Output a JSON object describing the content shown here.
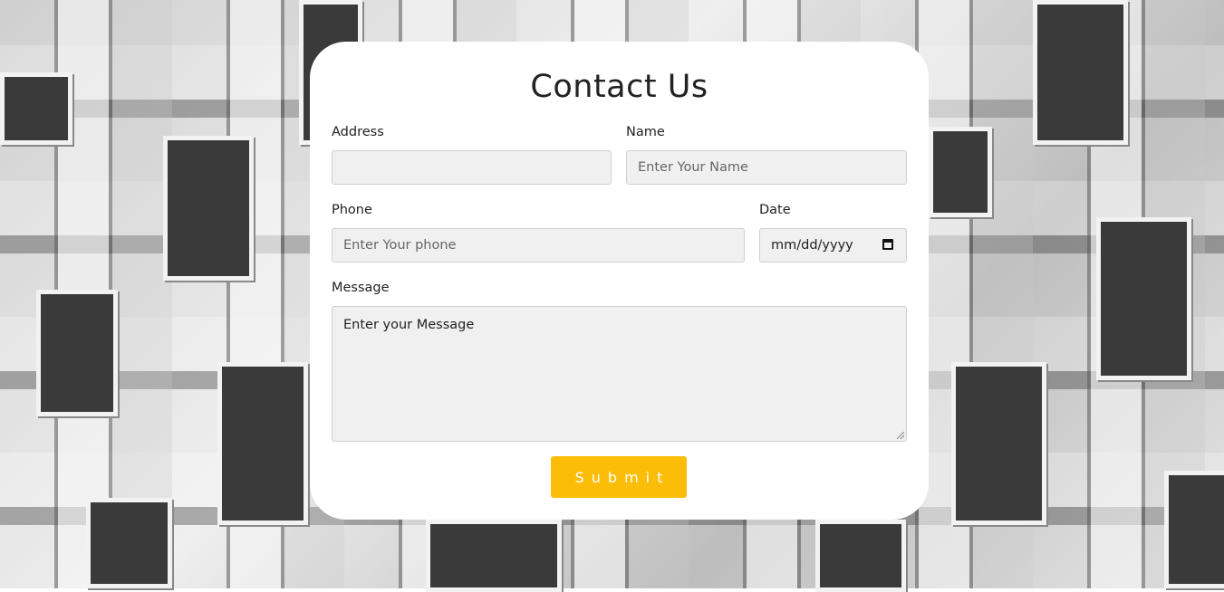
{
  "form": {
    "title": "Contact Us",
    "address": {
      "label": "Address",
      "value": ""
    },
    "name": {
      "label": "Name",
      "placeholder": "Enter Your Name"
    },
    "phone": {
      "label": "Phone",
      "placeholder": "Enter Your phone"
    },
    "date": {
      "label": "Date",
      "placeholder": "mm/dd/yyyy"
    },
    "message": {
      "label": "Message",
      "placeholder": "Enter your Message"
    },
    "submit_label": "Submit"
  },
  "colors": {
    "submit_button": "#fbbd08",
    "input_background": "#f0f0f0",
    "card_background": "#ffffff"
  },
  "icons": {
    "date_picker": "calendar-icon",
    "textarea_resize": "resize-handle-icon"
  }
}
